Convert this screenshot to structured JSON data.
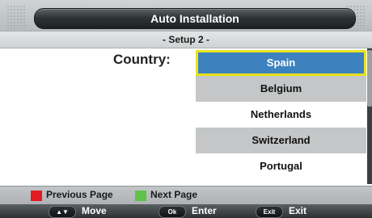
{
  "header": {
    "title": "Auto Installation"
  },
  "subheader": {
    "title": "- Setup 2 -"
  },
  "main": {
    "country_label": "Country:",
    "countries": [
      "Spain",
      "Belgium",
      "Netherlands",
      "Switzerland",
      "Portugal"
    ],
    "selected": "Spain"
  },
  "pagenav": {
    "previous": {
      "label": "Previous Page",
      "color": "#e11b22"
    },
    "next": {
      "label": "Next Page",
      "color": "#5cc24a"
    }
  },
  "footer": {
    "move": {
      "key": "▲▼",
      "label": "Move"
    },
    "enter": {
      "key": "Ok",
      "label": "Enter"
    },
    "exit": {
      "key": "Exit",
      "label": "Exit"
    }
  },
  "colors": {
    "selection": "#3d82bf",
    "selection_border": "#e9e21a",
    "row_shade": "#c4c6c7"
  }
}
